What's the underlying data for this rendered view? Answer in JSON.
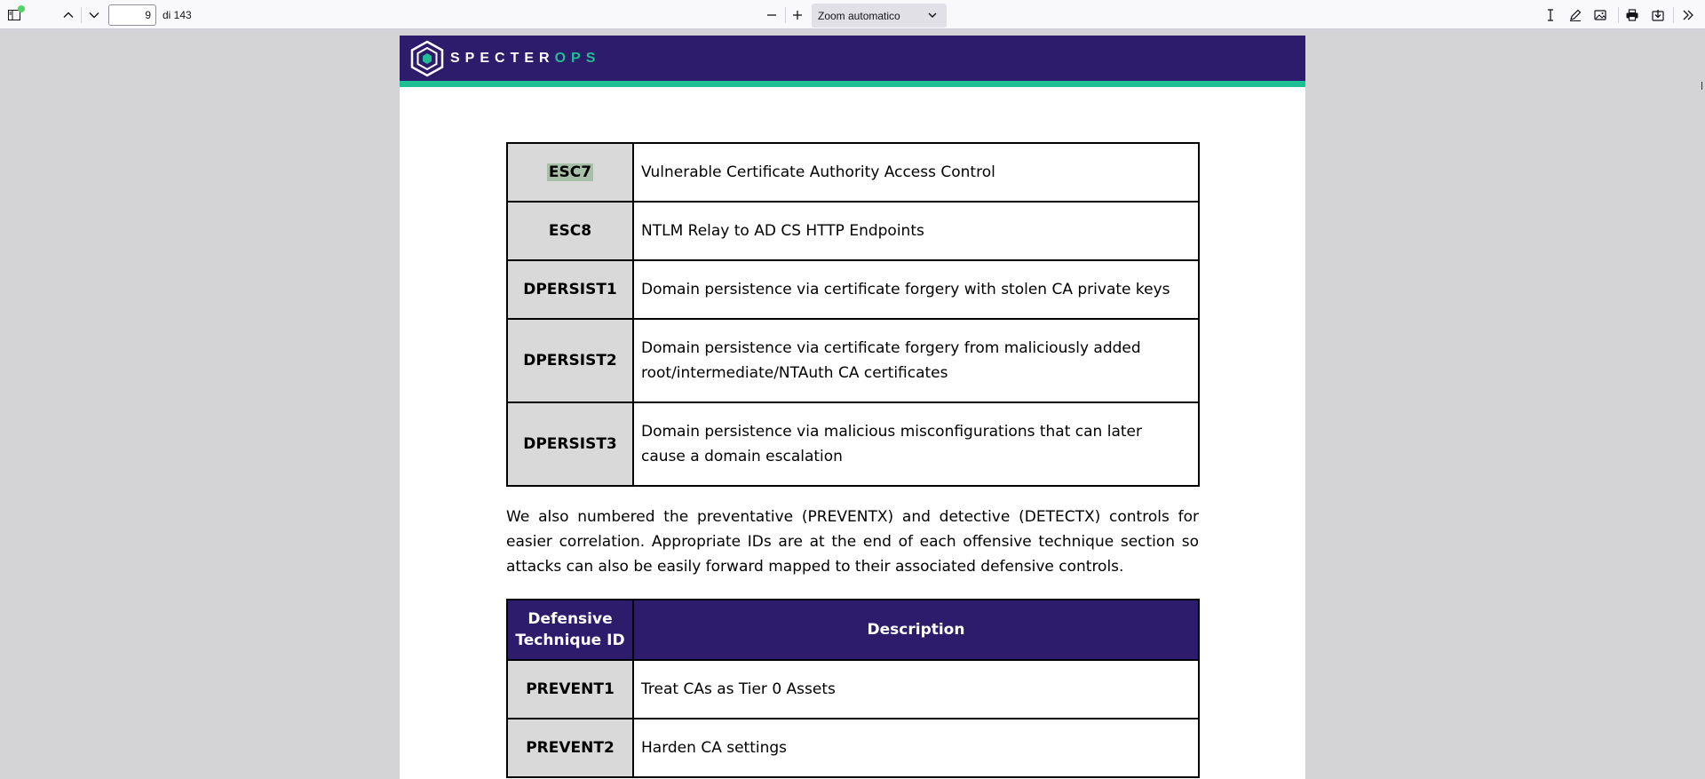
{
  "toolbar": {
    "page_number": "9",
    "page_total": "di 143",
    "zoom": "Zoom automatico"
  },
  "banner": {
    "logo_text_a": "SPECTER",
    "logo_text_b": "OPS",
    "accent": "#1ebf95",
    "brand": "#2d1b6b"
  },
  "offensive_table": {
    "rows": [
      {
        "id": "ESC7",
        "desc": "Vulnerable Certificate Authority Access Control"
      },
      {
        "id": "ESC8",
        "desc": "NTLM Relay to AD CS HTTP Endpoints"
      },
      {
        "id": "DPERSIST1",
        "desc": "Domain persistence via certificate forgery with stolen CA private keys"
      },
      {
        "id": "DPERSIST2",
        "desc": "Domain persistence via certificate forgery from maliciously added root/intermediate/NTAuth CA certificates"
      },
      {
        "id": "DPERSIST3",
        "desc": "Domain persistence via malicious misconfigurations that can later cause a domain escalation"
      }
    ]
  },
  "paragraph": "We also numbered the preventative (PREVENTX) and detective (DETECTX) controls for easier correlation. Appropriate IDs are at the end of each offensive technique section so attacks can also be easily forward mapped to their associated defensive controls.",
  "defensive_table": {
    "header_id": "Defensive Technique ID",
    "header_desc": "Description",
    "rows": [
      {
        "id": "PREVENT1",
        "desc": "Treat CAs as Tier 0 Assets"
      },
      {
        "id": "PREVENT2",
        "desc": "Harden CA settings"
      }
    ]
  }
}
